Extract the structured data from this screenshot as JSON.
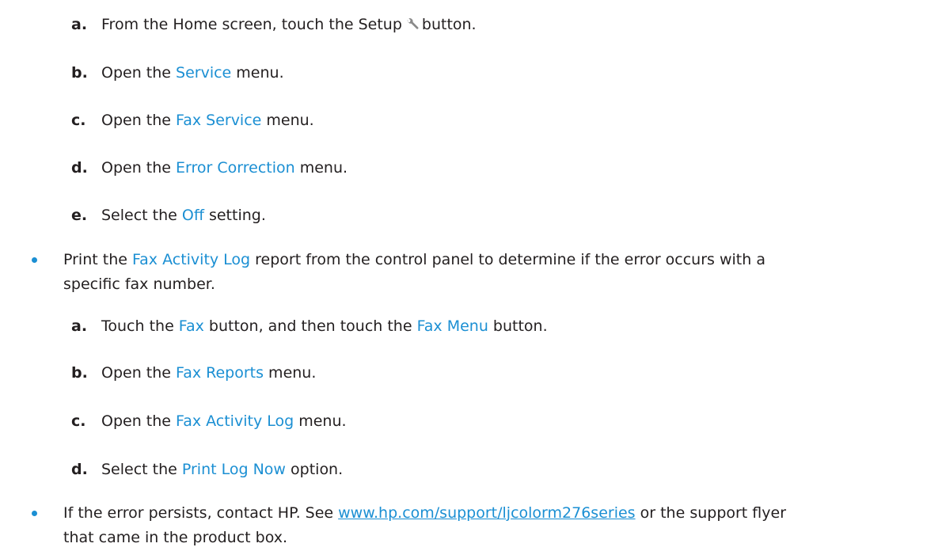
{
  "colors": {
    "highlight": "#1b8fd3",
    "text": "#231f20"
  },
  "list1": [
    {
      "letter": "a.",
      "pre": "From the Home screen, touch the Setup",
      "icon": "wrench-icon",
      "post": "button."
    },
    {
      "letter": "b.",
      "pre": "Open the ",
      "hl": "Service",
      "post": " menu."
    },
    {
      "letter": "c.",
      "pre": "Open the ",
      "hl": "Fax Service",
      "post": " menu."
    },
    {
      "letter": "d.",
      "pre": "Open the ",
      "hl": "Error Correction",
      "post": " menu."
    },
    {
      "letter": "e.",
      "pre": "Select the ",
      "hl": "Off",
      "post": " setting."
    }
  ],
  "bullet1": {
    "pre": "Print the ",
    "hl": "Fax Activity Log",
    "line1_post": " report from the control panel to determine if the error occurs with a",
    "line2": "specific fax number."
  },
  "list2": [
    {
      "letter": "a.",
      "pre": "Touch the ",
      "hl": "Fax",
      "mid": " button, and then touch the ",
      "hl2": "Fax Menu",
      "post": " button."
    },
    {
      "letter": "b.",
      "pre": "Open the ",
      "hl": "Fax Reports",
      "post": " menu."
    },
    {
      "letter": "c.",
      "pre": "Open the ",
      "hl": "Fax Activity Log",
      "post": " menu."
    },
    {
      "letter": "d.",
      "pre": "Select the ",
      "hl": "Print Log Now",
      "post": " option."
    }
  ],
  "bullet2": {
    "pre": "If the error persists, contact HP. See ",
    "link": "www.hp.com/support/ljcolorm276series",
    "line1_post": " or the support flyer",
    "line2": "that came in the product box."
  }
}
